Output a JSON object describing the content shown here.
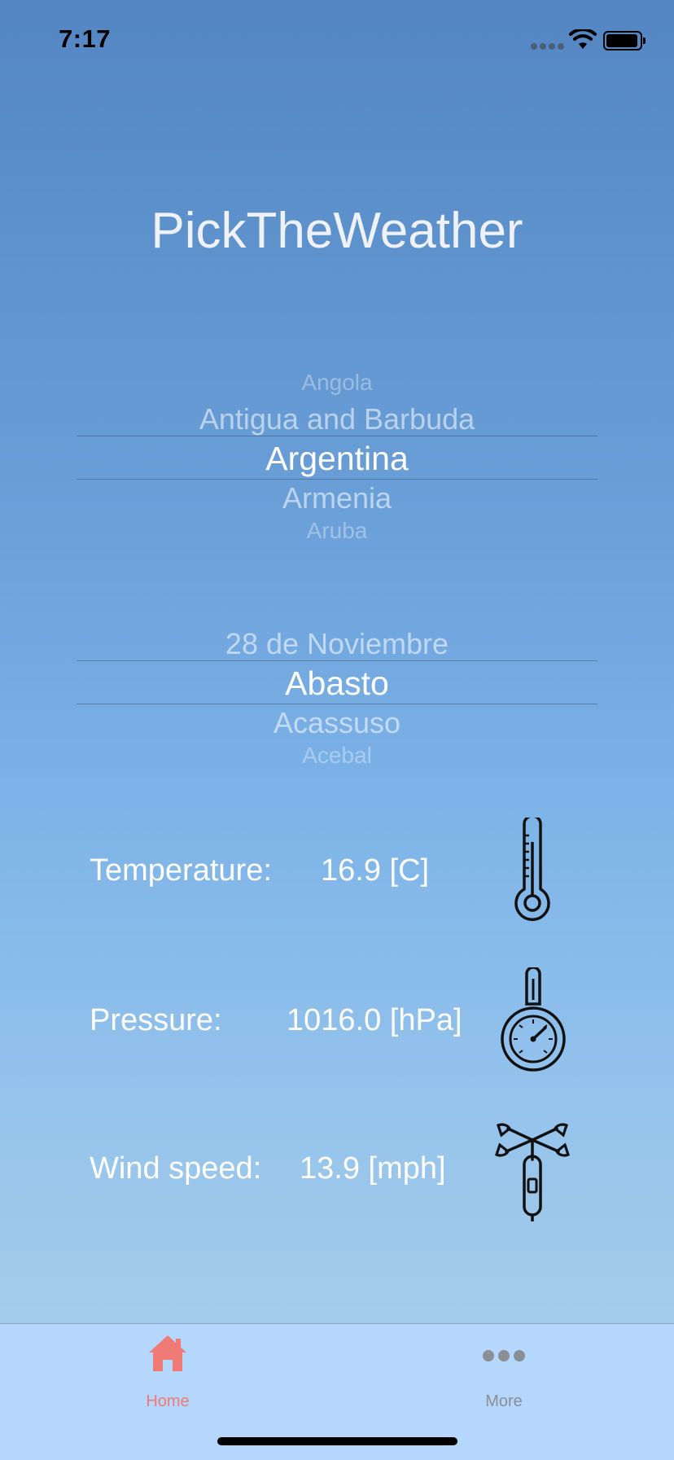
{
  "status_bar": {
    "time": "7:17"
  },
  "app": {
    "title": "PickTheWeather"
  },
  "country_picker": {
    "items": [
      "Angola",
      "Antigua and Barbuda",
      "Argentina",
      "Armenia",
      "Aruba"
    ],
    "selected": "Argentina"
  },
  "city_picker": {
    "items": [
      "28 de Noviembre",
      "Abasto",
      "Acassuso",
      "Acebal"
    ],
    "selected": "Abasto"
  },
  "weather": {
    "temperature": {
      "label": "Temperature:",
      "value": "16.9 [C]",
      "icon": "thermometer-icon"
    },
    "pressure": {
      "label": "Pressure:",
      "value": "1016.0 [hPa]",
      "icon": "barometer-icon"
    },
    "wind": {
      "label": "Wind speed:",
      "value": "13.9 [mph]",
      "icon": "anemometer-icon"
    }
  },
  "tabbar": {
    "home_label": "Home",
    "more_label": "More",
    "active_color": "#f07a75",
    "inactive_color": "#8a8e95"
  }
}
